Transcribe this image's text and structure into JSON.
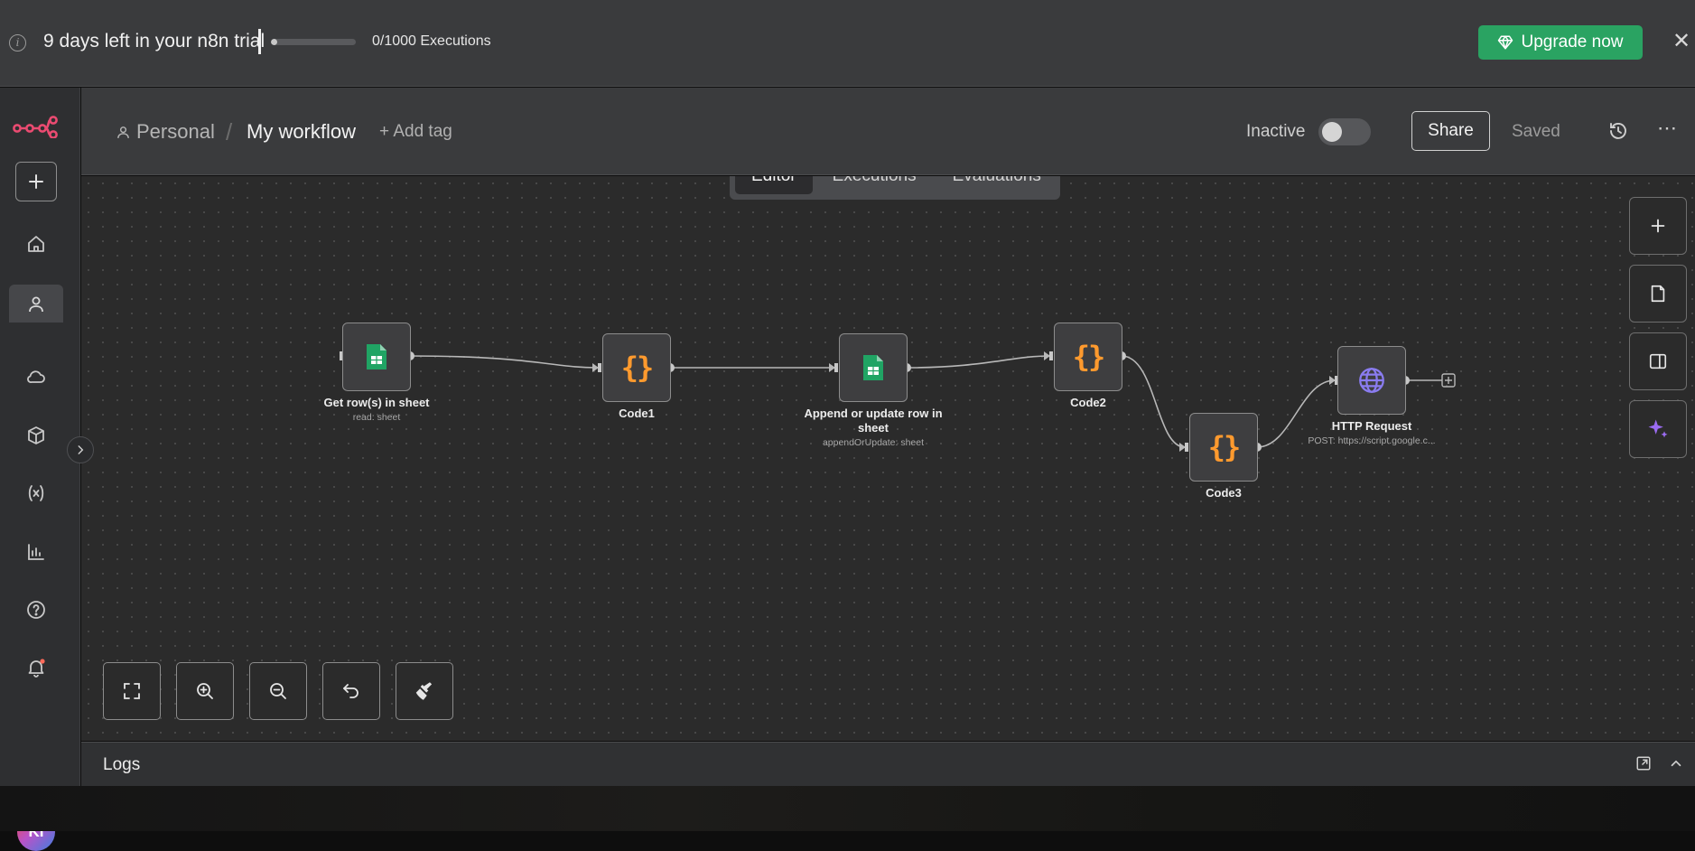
{
  "trial": {
    "text": "9 days left in your n8n trial",
    "executions": "0/1000 Executions",
    "progress_fraction": 0.0,
    "upgrade_label": "Upgrade now",
    "info_icon": "info-icon",
    "close_icon": "close-icon"
  },
  "sidebar": {
    "logo": "n8n-logo",
    "items": [
      {
        "name": "add",
        "icon": "plus-icon"
      },
      {
        "name": "overview",
        "icon": "home-icon"
      },
      {
        "name": "personal",
        "icon": "user-icon"
      },
      {
        "name": "cloud",
        "icon": "cloud-icon"
      },
      {
        "name": "templates",
        "icon": "box-icon"
      },
      {
        "name": "variables",
        "icon": "variables-icon"
      },
      {
        "name": "insights",
        "icon": "chart-icon"
      },
      {
        "name": "help",
        "icon": "help-icon"
      },
      {
        "name": "notifications",
        "icon": "bell-icon"
      }
    ],
    "avatar_initials": "KI"
  },
  "header": {
    "project": "Personal",
    "workflow_name": "My workflow",
    "add_tag": "+ Add tag",
    "status": "Inactive",
    "share_label": "Share",
    "saved_label": "Saved",
    "more": "⋯"
  },
  "tabs": [
    {
      "label": "Editor",
      "active": true
    },
    {
      "label": "Executions",
      "active": false
    },
    {
      "label": "Evaluations",
      "active": false
    }
  ],
  "nodes": [
    {
      "id": "get-rows",
      "label": "Get row(s) in sheet",
      "sub": "read: sheet",
      "type": "google-sheets"
    },
    {
      "id": "code1",
      "label": "Code1",
      "sub": "",
      "type": "code"
    },
    {
      "id": "append-update",
      "label": "Append or update row in sheet",
      "sub": "appendOrUpdate: sheet",
      "type": "google-sheets"
    },
    {
      "id": "code2",
      "label": "Code2",
      "sub": "",
      "type": "code"
    },
    {
      "id": "code3",
      "label": "Code3",
      "sub": "",
      "type": "code"
    },
    {
      "id": "http",
      "label": "HTTP Request",
      "sub": "POST: https://script.google.c...",
      "type": "http"
    }
  ],
  "code_glyph": "{}",
  "logs": {
    "label": "Logs"
  },
  "colors": {
    "accent_green": "#2aa362",
    "code_orange": "#ff9a2e",
    "sheets_green": "#20a464",
    "http_purple": "#8a7cf0",
    "logo_pink": "#ea4b71",
    "ai_purple": "#9b6cf2"
  }
}
